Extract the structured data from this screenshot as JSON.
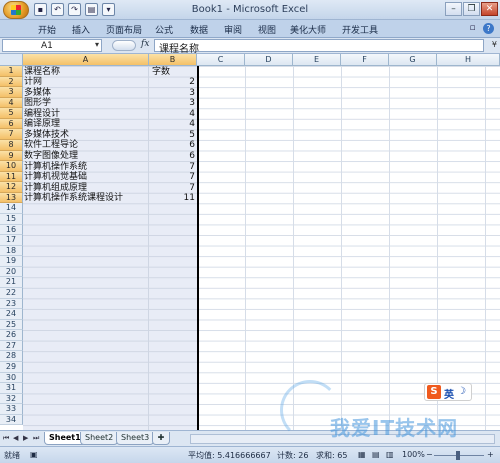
{
  "window": {
    "title": "Book1 - Microsoft Excel"
  },
  "ribbon_tabs": [
    "开始",
    "插入",
    "页面布局",
    "公式",
    "数据",
    "审阅",
    "视图",
    "美化大师",
    "开发工具"
  ],
  "formula_bar": {
    "name_box": "A1",
    "fx": "fx",
    "content": "课程名称"
  },
  "columns": [
    "A",
    "B",
    "C",
    "D",
    "E",
    "F",
    "G",
    "H"
  ],
  "rows": [
    "1",
    "2",
    "3",
    "4",
    "5",
    "6",
    "7",
    "8",
    "9",
    "10",
    "11",
    "12",
    "13",
    "14",
    "15",
    "16",
    "17",
    "18",
    "19",
    "20",
    "21",
    "22",
    "23",
    "24",
    "25",
    "26",
    "27",
    "28",
    "29",
    "30",
    "31",
    "32",
    "33",
    "34"
  ],
  "header_row": {
    "a": "课程名称",
    "b": "字数"
  },
  "data_rows": [
    {
      "a": "计网",
      "b": "2"
    },
    {
      "a": "多媒体",
      "b": "3"
    },
    {
      "a": "图形学",
      "b": "3"
    },
    {
      "a": "编程设计",
      "b": "4"
    },
    {
      "a": "编译原理",
      "b": "4"
    },
    {
      "a": "多媒体技术",
      "b": "5"
    },
    {
      "a": "软件工程导论",
      "b": "6"
    },
    {
      "a": "数字图像处理",
      "b": "6"
    },
    {
      "a": "计算机操作系统",
      "b": "7"
    },
    {
      "a": "计算机视觉基础",
      "b": "7"
    },
    {
      "a": "计算机组成原理",
      "b": "7"
    },
    {
      "a": "计算机操作系统课程设计",
      "b": "11"
    }
  ],
  "sheets": [
    "Sheet1",
    "Sheet2",
    "Sheet3"
  ],
  "active_sheet": "Sheet1",
  "status": {
    "mode": "就绪",
    "average": "平均值: 5.416666667",
    "count": "计数: 26",
    "sum": "求和: 65",
    "zoom": "100%"
  },
  "ime": {
    "logo": "S",
    "mode": "英"
  },
  "watermark": "我爱IT技术网"
}
